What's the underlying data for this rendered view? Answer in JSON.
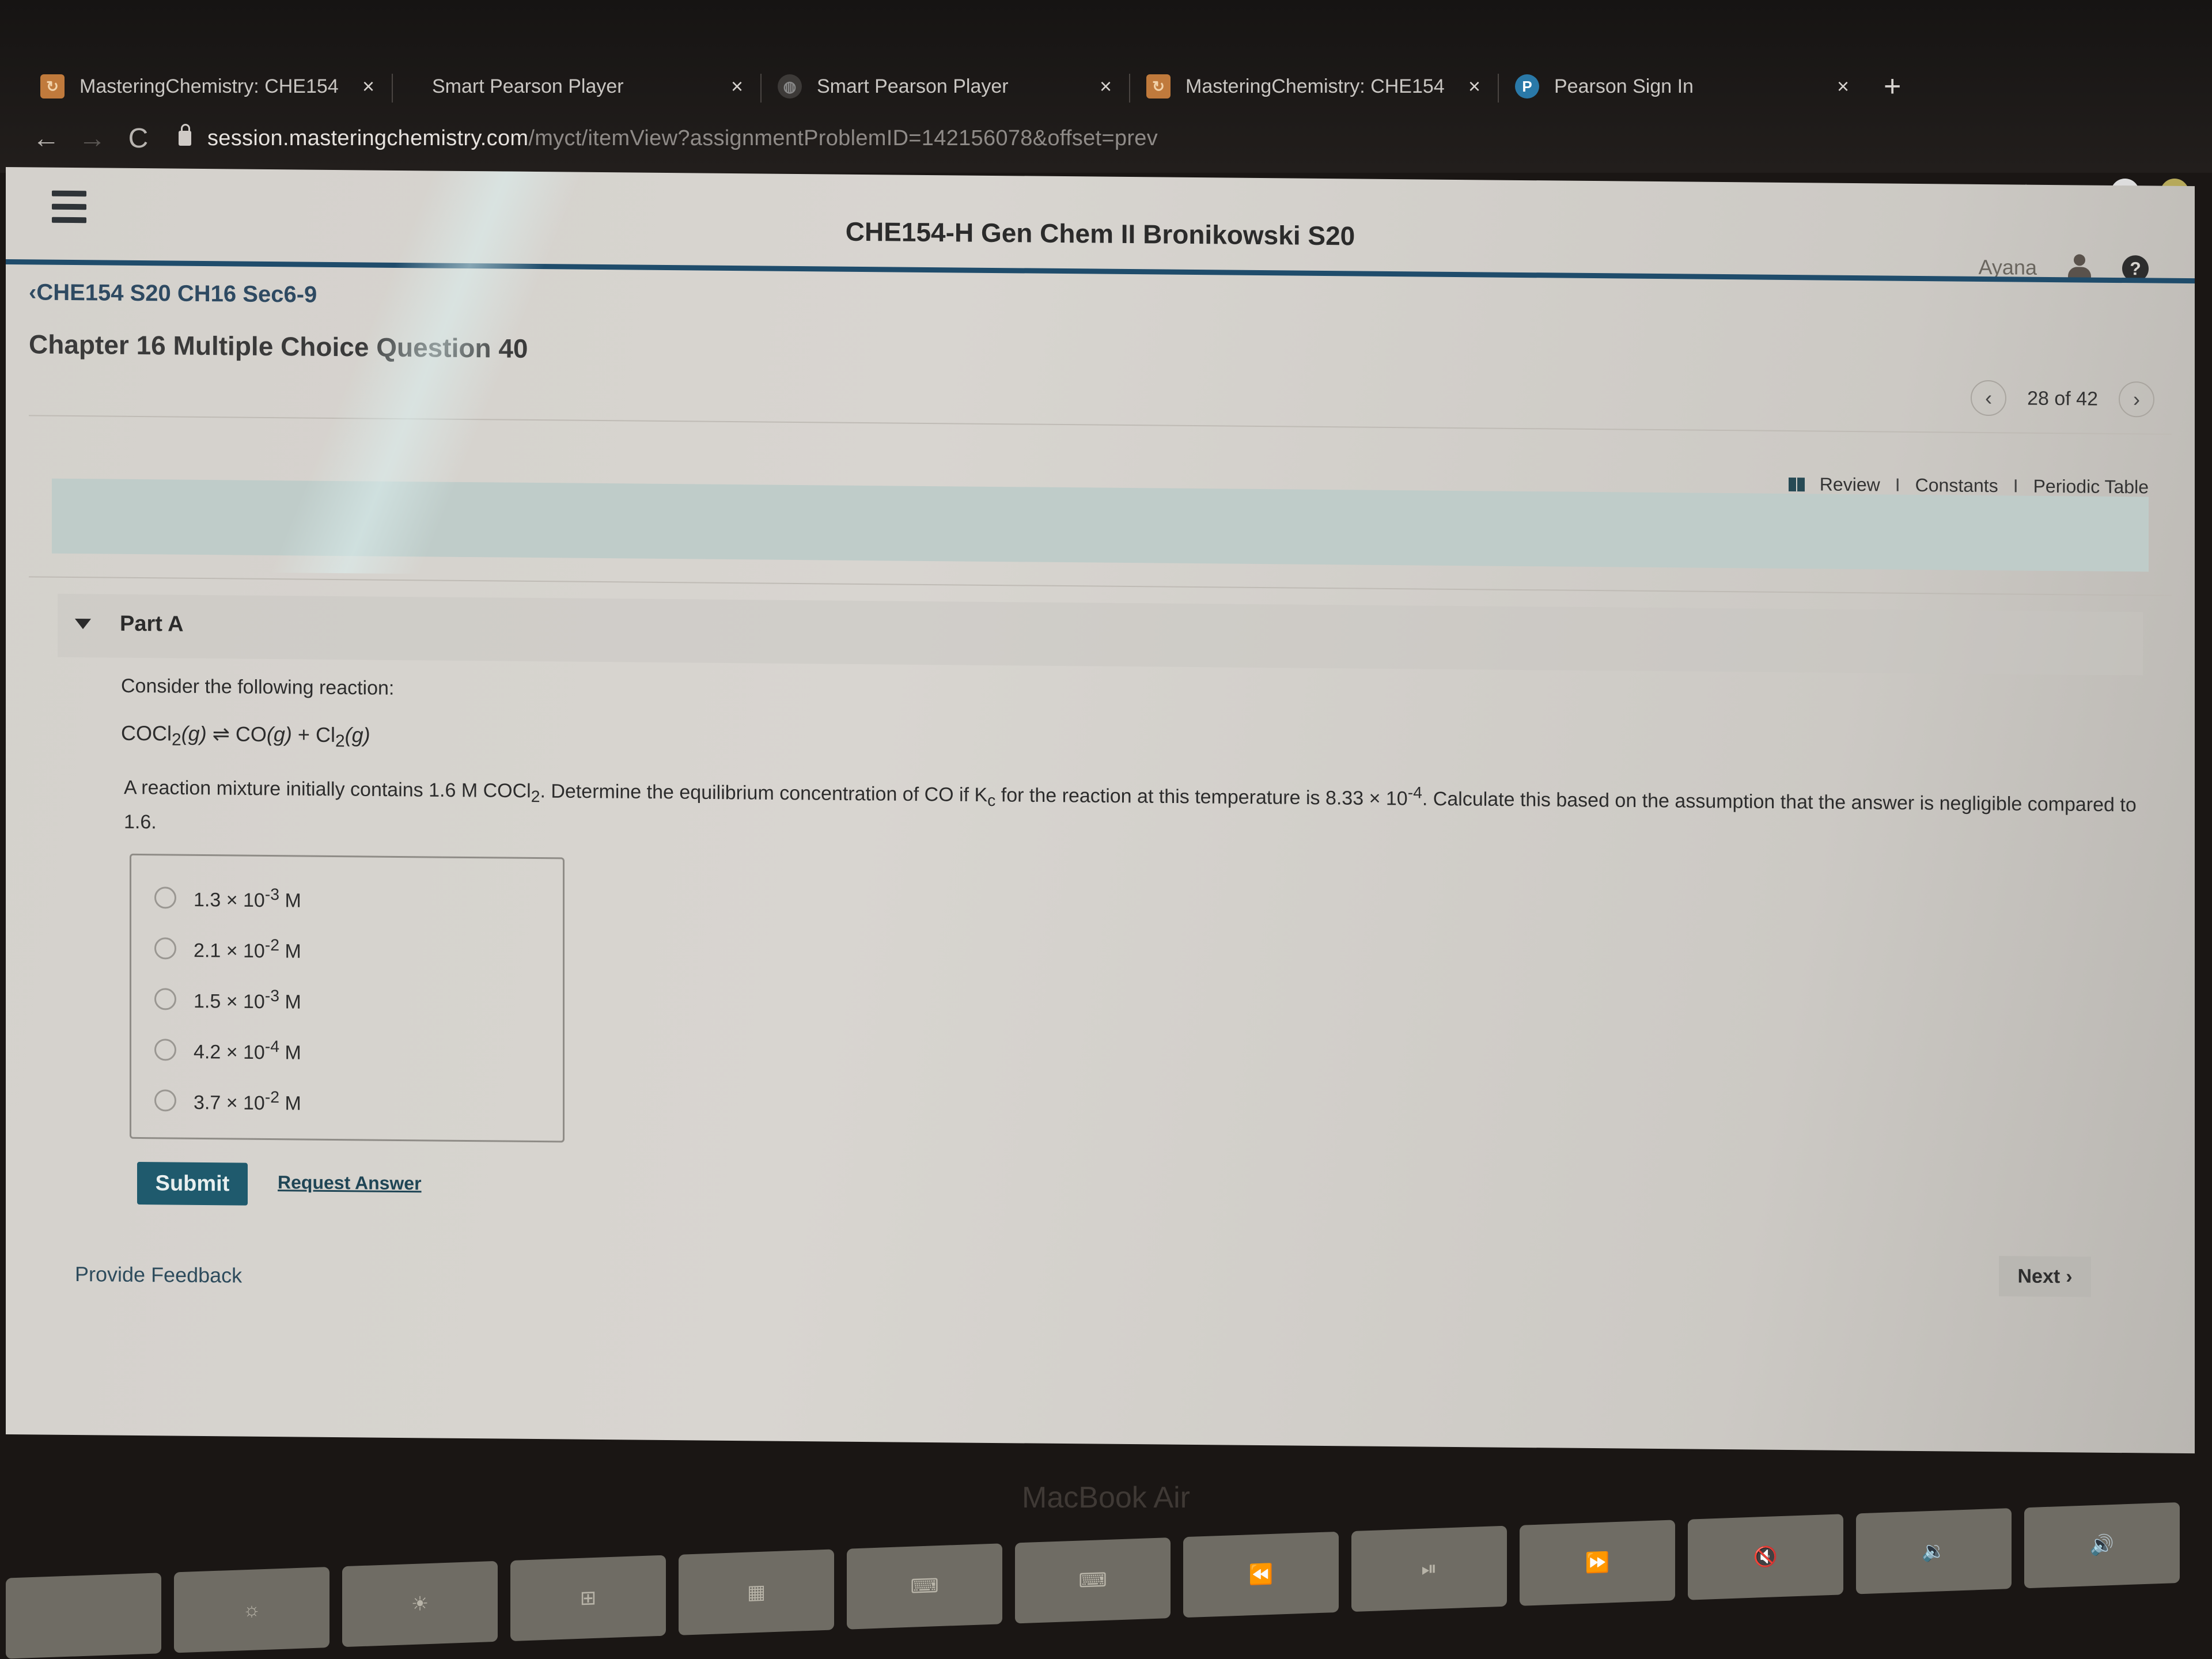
{
  "browser": {
    "tabs": [
      {
        "label": "MasteringChemistry: CHE154",
        "favicon": "mastering-icon",
        "close": "×"
      },
      {
        "label": "Smart Pearson Player",
        "favicon": "pearson-player-icon",
        "close": "×"
      },
      {
        "label": "Smart Pearson Player",
        "favicon": "pearson-player-icon",
        "close": "×"
      },
      {
        "label": "MasteringChemistry: CHE154",
        "favicon": "mastering-icon",
        "close": "×"
      },
      {
        "label": "Pearson Sign In",
        "favicon": "pearson-icon",
        "close": "×"
      }
    ],
    "new_tab": "+",
    "nav": {
      "back": "←",
      "forward": "→",
      "reload": "C"
    },
    "url_host": "session.masteringchemistry.com",
    "url_path": "/myct/itemView?assignmentProblemID=142156078&offset=prev",
    "toolbar_icons": [
      "star-icon",
      "media-icon",
      "profile-icon",
      "extension-icon"
    ]
  },
  "header": {
    "menu_icon": "hamburger-icon",
    "course_title": "CHE154-H Gen Chem II Bronikowski S20",
    "user_name": "Ayana",
    "help_icon": "?"
  },
  "breadcrumb": "‹CHE154 S20 CH16 Sec6-9",
  "question_title": "Chapter 16 Multiple Choice Question 40",
  "pager": {
    "prev": "‹",
    "text": "28 of 42",
    "next": "›",
    "current": 28,
    "total": 42
  },
  "resources": {
    "review": "Review",
    "constants": "Constants",
    "periodic_table": "Periodic Table",
    "separator": "I"
  },
  "part": {
    "label": "Part A",
    "intro": "Consider the following reaction:",
    "reaction": {
      "reactant": "COCl",
      "reactant_sub": "2",
      "reactant_state": "(g)",
      "arrow": "⇌",
      "product1": "CO",
      "product1_state": "(g)",
      "plus": "+",
      "product2": "Cl",
      "product2_sub": "2",
      "product2_state": "(g)"
    },
    "prompt": {
      "p1": "A reaction mixture initially contains 1.6 M COCl",
      "p1_sub": "2",
      "p2": ". Determine the equilibrium concentration of CO if K",
      "p2_sub": "c",
      "p3": " for the reaction at this temperature is 8.33 × 10",
      "p3_sup": "-4",
      "p4": ". Calculate this based on the assumption that the answer is negligible compared to 1.6."
    },
    "choices": [
      {
        "mantissa": "1.3 × 10",
        "exp": "-3",
        "unit": " M"
      },
      {
        "mantissa": "2.1 × 10",
        "exp": "-2",
        "unit": " M"
      },
      {
        "mantissa": "1.5 × 10",
        "exp": "-3",
        "unit": " M"
      },
      {
        "mantissa": "4.2 × 10",
        "exp": "-4",
        "unit": " M"
      },
      {
        "mantissa": "3.7 × 10",
        "exp": "-2",
        "unit": " M"
      }
    ],
    "submit": "Submit",
    "request_answer": "Request Answer"
  },
  "footer": {
    "feedback": "Provide Feedback",
    "next": "Next",
    "next_icon": "›"
  },
  "device": {
    "label": "MacBook Air"
  },
  "colors": {
    "brand_blue": "#1f4c6b",
    "submit_bg": "#1f5a6d",
    "intro_band": "#bfccc9"
  }
}
